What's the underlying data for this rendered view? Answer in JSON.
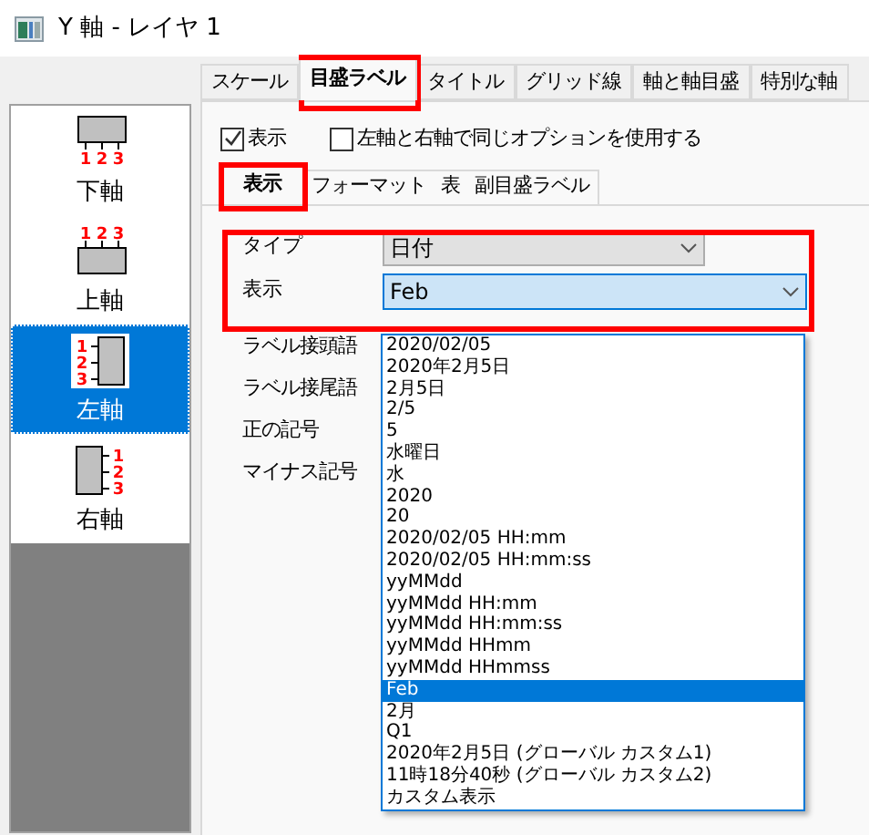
{
  "window": {
    "title": "Y 軸 - レイヤ 1"
  },
  "tabs": [
    {
      "label": "スケール",
      "selected": false
    },
    {
      "label": "目盛ラベル",
      "selected": true
    },
    {
      "label": "タイトル",
      "selected": false
    },
    {
      "label": "グリッド線",
      "selected": false
    },
    {
      "label": "軸と軸目盛",
      "selected": false
    },
    {
      "label": "特別な軸",
      "selected": false
    }
  ],
  "sidebar": {
    "items": [
      {
        "label": "下軸",
        "kind": "bottom",
        "selected": false,
        "ticks": [
          "1",
          "2",
          "3"
        ]
      },
      {
        "label": "上軸",
        "kind": "top",
        "selected": false,
        "ticks": [
          "1",
          "2",
          "3"
        ]
      },
      {
        "label": "左軸",
        "kind": "left",
        "selected": true,
        "ticks": [
          "1",
          "2",
          "3"
        ]
      },
      {
        "label": "右軸",
        "kind": "right",
        "selected": false,
        "ticks": [
          "1",
          "2",
          "3"
        ]
      }
    ]
  },
  "checkboxes": [
    {
      "label": "表示",
      "checked": true
    },
    {
      "label": "左軸と右軸で同じオプションを使用する",
      "checked": false
    }
  ],
  "subtabs": [
    {
      "label": "表示",
      "selected": true
    },
    {
      "label": "フォーマット",
      "selected": false
    },
    {
      "label": "表",
      "selected": false
    },
    {
      "label": "副目盛ラベル",
      "selected": false
    }
  ],
  "type_field": {
    "label": "タイプ",
    "value": "日付"
  },
  "display_field": {
    "label": "表示",
    "value": "Feb",
    "expanded": true
  },
  "other_labels": [
    "ラベル接頭語",
    "ラベル接尾語",
    "正の記号",
    "マイナス記号"
  ],
  "options": [
    {
      "label": "2020/02/05",
      "selected": false
    },
    {
      "label": "2020年2月5日",
      "selected": false
    },
    {
      "label": "2月5日",
      "selected": false
    },
    {
      "label": "2/5",
      "selected": false
    },
    {
      "label": "5",
      "selected": false
    },
    {
      "label": "水曜日",
      "selected": false
    },
    {
      "label": "水",
      "selected": false
    },
    {
      "label": "2020",
      "selected": false
    },
    {
      "label": "20",
      "selected": false
    },
    {
      "label": "2020/02/05 HH:mm",
      "selected": false
    },
    {
      "label": "2020/02/05 HH:mm:ss",
      "selected": false
    },
    {
      "label": "yyMMdd",
      "selected": false
    },
    {
      "label": "yyMMdd HH:mm",
      "selected": false
    },
    {
      "label": "yyMMdd HH:mm:ss",
      "selected": false
    },
    {
      "label": "yyMMdd HHmm",
      "selected": false
    },
    {
      "label": "yyMMdd HHmmss",
      "selected": false
    },
    {
      "label": "Feb",
      "selected": true
    },
    {
      "label": "2月",
      "selected": false
    },
    {
      "label": "Q1",
      "selected": false
    },
    {
      "label": "2020年2月5日 (グローバル カスタム1)",
      "selected": false
    },
    {
      "label": "11時18分40秒 (グローバル カスタム2)",
      "selected": false
    },
    {
      "label": "カスタム表示",
      "selected": false
    }
  ]
}
